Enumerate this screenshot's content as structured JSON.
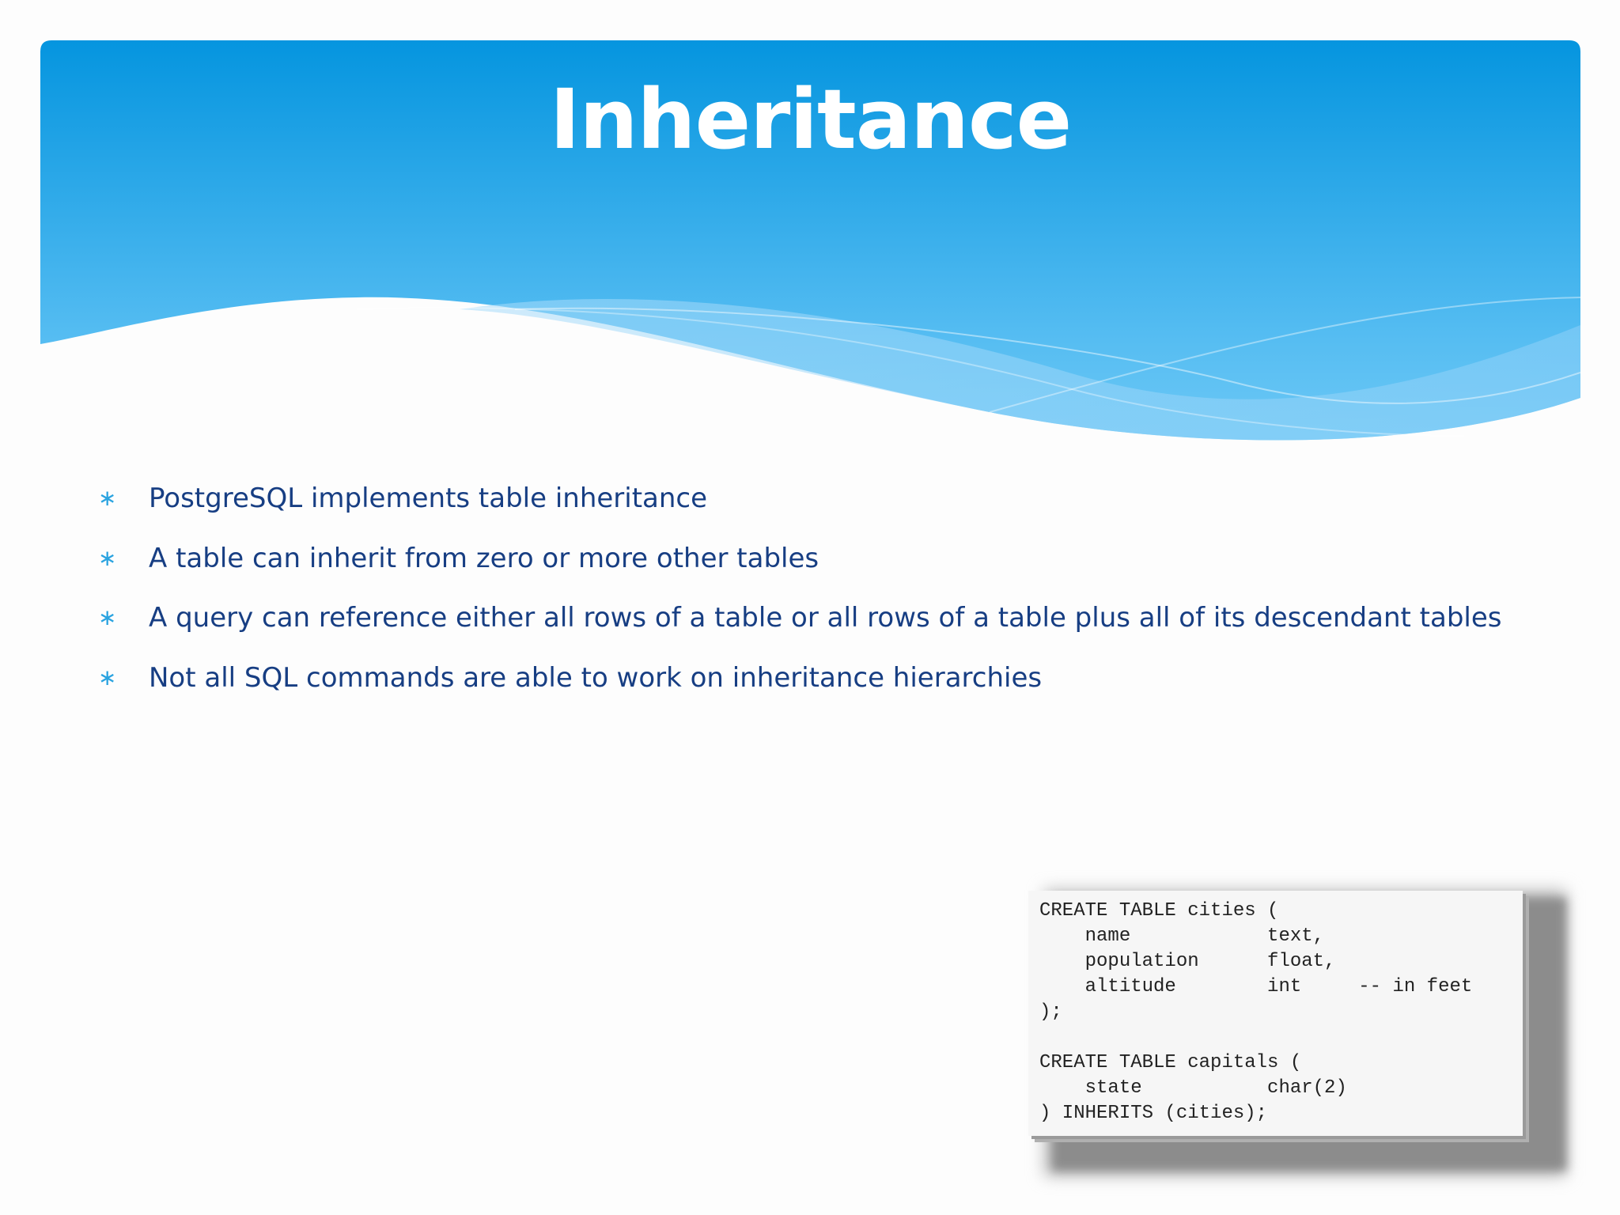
{
  "slide": {
    "title": "Inheritance",
    "bullet_marker": "∗",
    "bullets": [
      "PostgreSQL implements table inheritance",
      "A table can inherit from zero or more other tables",
      "A query can reference either all rows of a table or all rows of a table plus all of its descendant tables",
      "Not all SQL commands are able to work on inheritance hierarchies"
    ],
    "code": "CREATE TABLE cities (\n    name            text,\n    population      float,\n    altitude        int     -- in feet\n);\n\nCREATE TABLE capitals (\n    state           char(2)\n) INHERITS (cities);"
  },
  "colors": {
    "header_top": "#0595df",
    "header_bottom": "#5ec0f4",
    "title": "#ffffff",
    "bullet_text": "#173e83",
    "bullet_marker": "#2aa3e0"
  }
}
